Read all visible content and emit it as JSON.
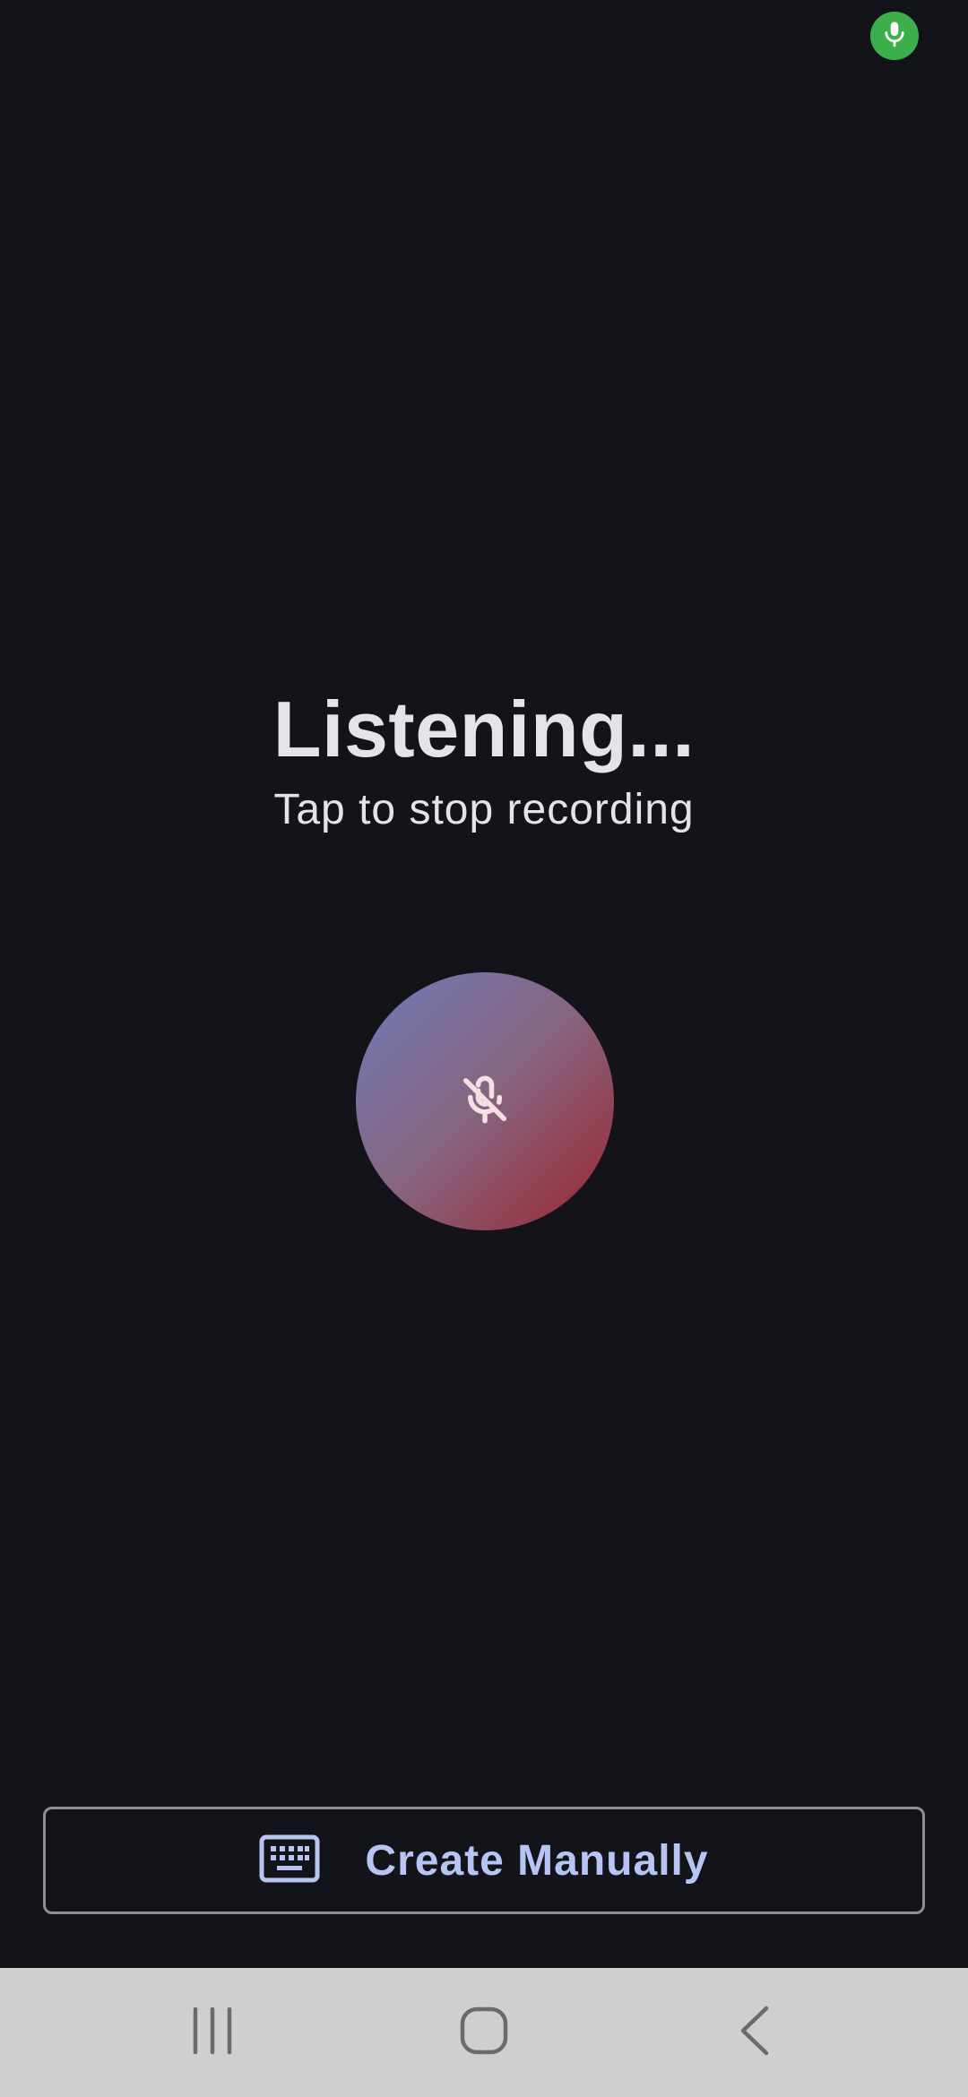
{
  "status_bar": {
    "mic_indicator_icon": "microphone-icon",
    "mic_indicator_color": "#3cae4c"
  },
  "main": {
    "title": "Listening...",
    "subtitle": "Tap to stop recording",
    "record_button_icon": "microphone-off-icon",
    "record_gradient": [
      "#6f7bb8",
      "#87647f",
      "#992630"
    ]
  },
  "footer": {
    "manual_button_icon": "keyboard-icon",
    "manual_button_label": "Create Manually",
    "accent_color": "#b7c5f4"
  },
  "nav_bar": {
    "recents_icon": "recents-icon",
    "home_icon": "home-icon",
    "back_icon": "back-icon"
  },
  "colors": {
    "background": "#131419",
    "text": "#e3e3e8",
    "nav_background": "#cfcfcf"
  }
}
